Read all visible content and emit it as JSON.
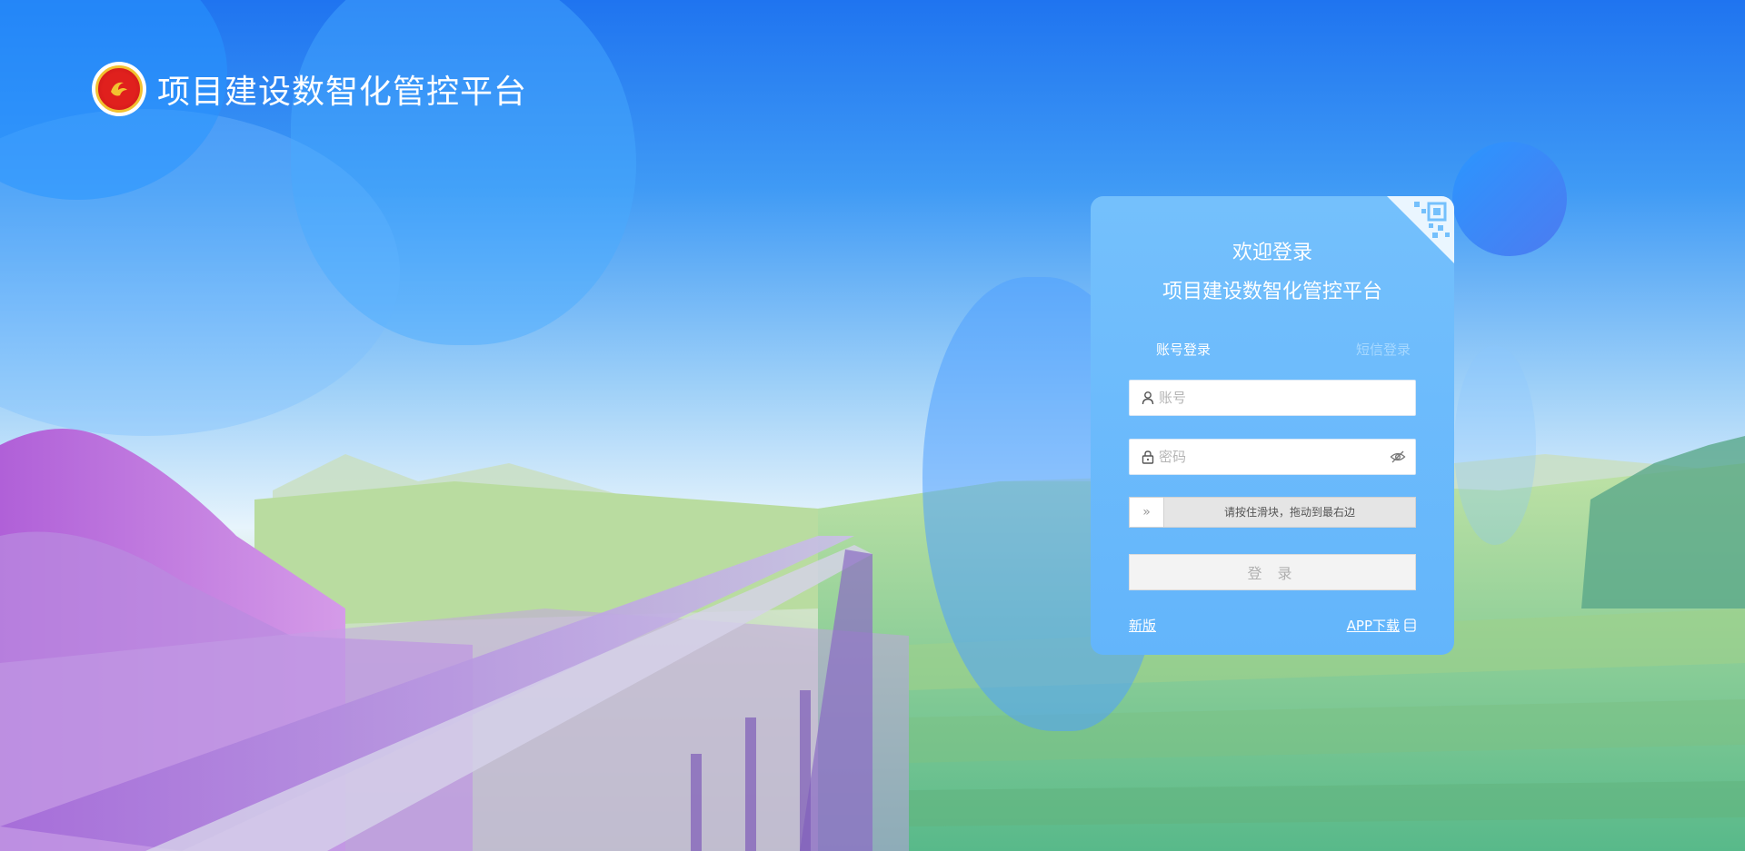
{
  "brand": {
    "title": "项目建设数智化管控平台"
  },
  "login": {
    "welcome": "欢迎登录",
    "subtitle": "项目建设数智化管控平台",
    "tabs": [
      {
        "label": "账号登录",
        "active": true
      },
      {
        "label": "短信登录",
        "active": false
      }
    ],
    "account_placeholder": "账号",
    "password_placeholder": "密码",
    "slider_text": "请按住滑块，拖动到最右边",
    "slider_handle": "»",
    "submit_label": "登 录",
    "link_new": "新版",
    "link_app": "APP下载"
  },
  "colors": {
    "card_bg": "#6ebcfc",
    "accent": "#1f74f0",
    "logo_red": "#e0201d",
    "logo_gold": "#f2c230"
  },
  "icons": [
    "user-icon",
    "lock-icon",
    "eye-off-icon",
    "qr-code-icon",
    "mobile-icon",
    "double-arrow-icon"
  ]
}
